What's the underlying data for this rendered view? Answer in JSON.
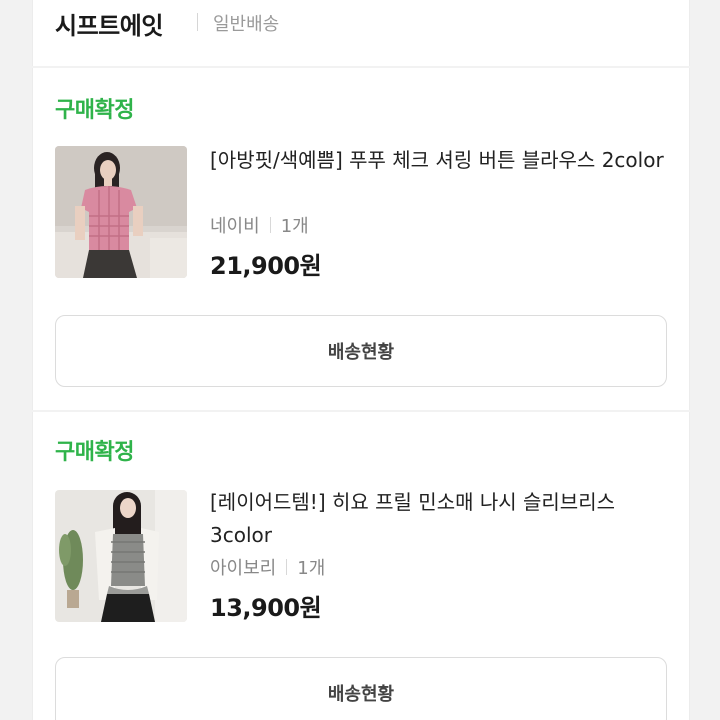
{
  "seller": {
    "name": "시프트에잇",
    "shipping_type": "일반배송"
  },
  "orders": [
    {
      "status": "구매확정",
      "title": "[아방핏/색예쁨] 푸푸 체크 셔링 버튼 블라우스 2color",
      "option": "네이비",
      "quantity": "1개",
      "price": "21,900원",
      "button_label": "배송현황"
    },
    {
      "status": "구매확정",
      "title": "[레이어드템!] 히요 프릴 민소매 나시 슬리브리스 3color",
      "option": "아이보리",
      "quantity": "1개",
      "price": "13,900원",
      "button_label": "배송현황"
    }
  ],
  "colors": {
    "status_green": "#2fb34a",
    "text_dark": "#1a1a1a",
    "text_muted": "#888888",
    "page_bg": "#f2f2f2"
  }
}
